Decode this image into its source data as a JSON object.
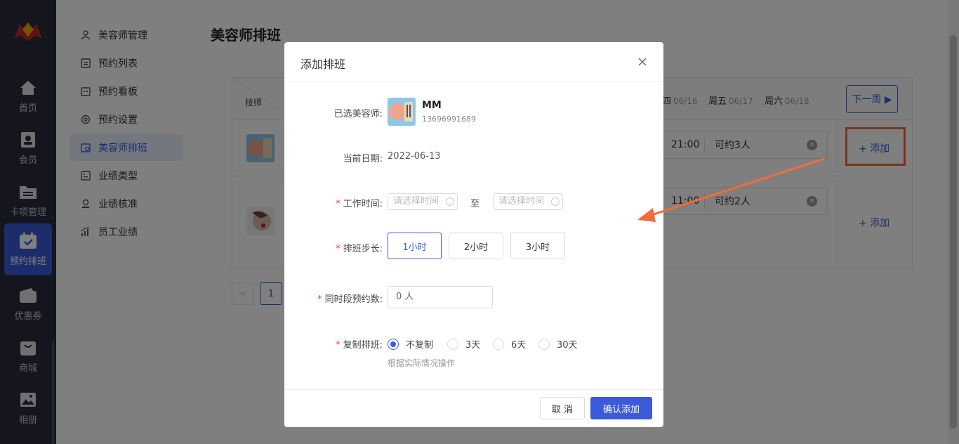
{
  "nav": {
    "items": [
      {
        "label": "首页",
        "icon": "home-icon"
      },
      {
        "label": "会员",
        "icon": "member-icon"
      },
      {
        "label": "卡项管理",
        "icon": "card-folder-icon"
      },
      {
        "label": "预约排班",
        "icon": "calendar-check-icon"
      },
      {
        "label": "优惠券",
        "icon": "wallet-icon"
      },
      {
        "label": "商城",
        "icon": "bag-icon"
      },
      {
        "label": "相册",
        "icon": "image-icon"
      }
    ],
    "active_index": 3
  },
  "submenu": {
    "items": [
      {
        "label": "美容师管理",
        "icon": "person-icon"
      },
      {
        "label": "预约列表",
        "icon": "list-icon"
      },
      {
        "label": "预约看板",
        "icon": "board-icon"
      },
      {
        "label": "预约设置",
        "icon": "settings-icon"
      },
      {
        "label": "美容师排班",
        "icon": "schedule-icon"
      },
      {
        "label": "业绩类型",
        "icon": "category-icon"
      },
      {
        "label": "业绩核准",
        "icon": "approve-icon"
      },
      {
        "label": "员工业绩",
        "icon": "chart-icon"
      }
    ],
    "active_index": 4
  },
  "page": {
    "title": "美容师排班",
    "tech_header": "技师",
    "days": [
      {
        "name": "四",
        "date": "06/16"
      },
      {
        "name": "周五",
        "date": "06/17"
      },
      {
        "name": "周六",
        "date": "06/18"
      }
    ],
    "next_week": "下一周 ▶",
    "rows": [
      {
        "time": "21:00",
        "capacity": "可约3人",
        "add": "+ 添加"
      },
      {
        "time": "11:00",
        "capacity": "可约2人",
        "add": "+ 添加"
      }
    ],
    "pager_current": "1",
    "pager_prev": "<"
  },
  "modal": {
    "title": "添加排班",
    "selected_label": "已选美容师:",
    "beautician_name": "MM",
    "beautician_phone": "13696991689",
    "date_label": "当前日期:",
    "date_value": "2022-06-13",
    "work_time_label": "工作时间:",
    "time_placeholder": "请选择时间",
    "to": "至",
    "step_label": "排班步长:",
    "steps": [
      "1小时",
      "2小时",
      "3小时"
    ],
    "step_selected": "1小时",
    "count_label": "同时段预约数:",
    "count_value": "0 人",
    "copy_label": "复制排班:",
    "copy_options": [
      "不复制",
      "3天",
      "6天",
      "30天"
    ],
    "copy_selected": "不复制",
    "hint": "根据实际情况操作",
    "cancel": "取 消",
    "confirm": "确认添加"
  },
  "colors": {
    "primary": "#3b5bd9",
    "nav_bg": "#2b2d3a",
    "annotation": "#f26b3a",
    "required": "#e4393c"
  }
}
